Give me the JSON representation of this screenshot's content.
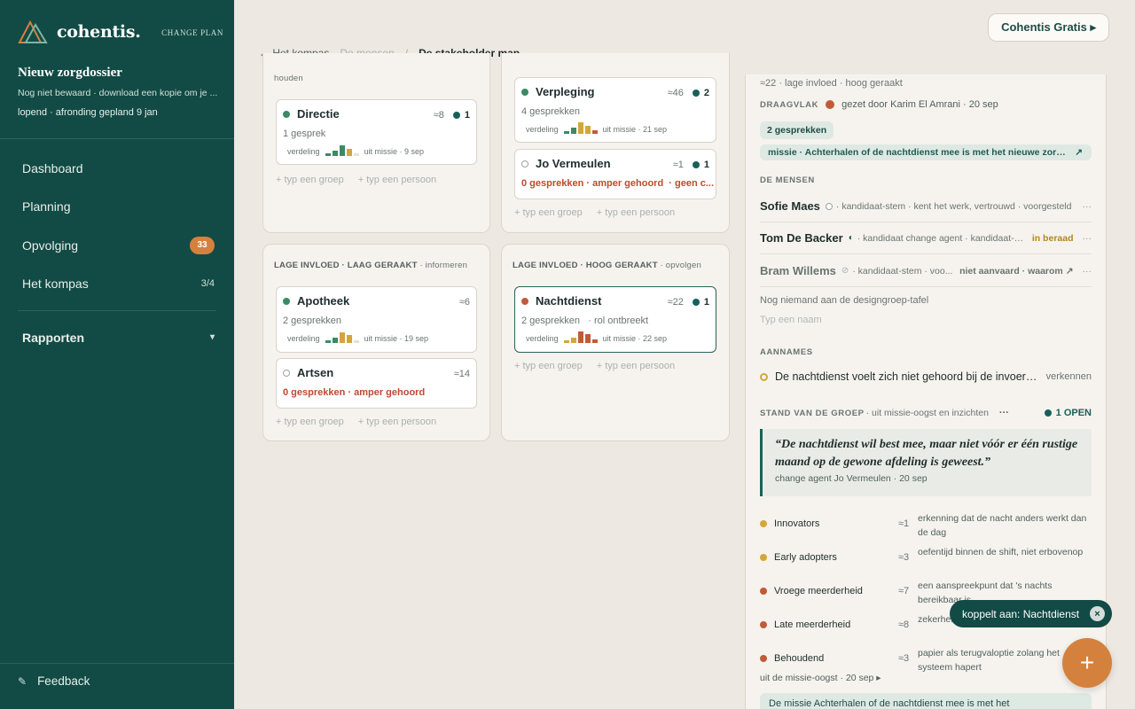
{
  "brand": {
    "name": "cohentis.",
    "change_plan": "CHANGE PLAN"
  },
  "dossier": {
    "title": "Nieuw zorgdossier",
    "note": "Nog niet bewaard · download een kopie om je ...",
    "status": "lopend · afronding gepland 9 jan"
  },
  "nav": {
    "dashboard": "Dashboard",
    "planning": "Planning",
    "opvolging": "Opvolging",
    "opvolging_badge": "33",
    "kompas": "Het kompas",
    "kompas_count": "3/4",
    "rapporten": "Rapporten",
    "rapporten_caret": "▾",
    "feedback": "Feedback",
    "feedback_icon": "✎"
  },
  "breadcrumb": {
    "back": "← Het kompas",
    "mid": "De mensen",
    "sep": "/",
    "current": "De stakeholder map"
  },
  "plan_button": "Cohentis Gratis ▸",
  "quadrants": {
    "q1_head_tail": "houden",
    "q3_head": "LAGE INVLOED · LAAG GERAAKT",
    "q3_tail": " · informeren",
    "q4_head": "LAGE INVLOED · HOOG GERAAKT",
    "q4_tail": " · opvolgen",
    "add_group": "+ typ een groep",
    "add_person": "+ typ een persoon"
  },
  "cards": {
    "directie": {
      "name": "Directie",
      "size": "≈8",
      "count": "1",
      "sub": "1 gesprek",
      "dist_label": "verdeling",
      "mission": "uit missie · 9 sep"
    },
    "verpleging": {
      "name": "Verpleging",
      "size": "≈46",
      "count": "2",
      "sub": "4 gesprekken",
      "dist_label": "verdeling",
      "mission": "uit missie · 21 sep"
    },
    "jo": {
      "name": "Jo Vermeulen",
      "size": "≈1",
      "count": "1",
      "sub": "0 gesprekken · amper gehoord",
      "sub2": "· geen c..."
    },
    "apotheek": {
      "name": "Apotheek",
      "size": "≈6",
      "sub": "2 gesprekken",
      "dist_label": "verdeling",
      "mission": "uit missie · 19 sep"
    },
    "artsen": {
      "name": "Artsen",
      "size": "≈14",
      "sub": "0 gesprekken · amper gehoord"
    },
    "nachtdienst": {
      "name": "Nachtdienst",
      "size": "≈22",
      "count": "1",
      "sub": "2 gesprekken",
      "sub2": "· rol ontbreekt",
      "dist_label": "verdeling",
      "mission": "uit missie · 22 sep"
    }
  },
  "panel": {
    "top_meta": "≈22 · lage invloed · hoog geraakt",
    "draagvlak_label": "DRAAGVLAK",
    "draagvlak_text": "gezet door Karim El Amrani · 20 sep",
    "gesprekken_pill": "2 gesprekken",
    "missie_pill": "missie · Achterhalen of de nachtdienst mee is met het nieuwe zorgdossier",
    "missie_arrow": "↗",
    "mensen_label": "DE MENSEN",
    "people": [
      {
        "name": "Sofie Maes",
        "desc": "· kandidaat-stem · kent het werk, vertrouwd · voorgesteld"
      },
      {
        "name": "Tom De Backer",
        "desc": "· kandidaat change agent · kandidaat-stem",
        "tag": "in beraad"
      },
      {
        "name": "Bram Willems",
        "desc": "· kandidaat-stem · voo...",
        "tag": "niet aanvaard · waarom ↗"
      }
    ],
    "more_icon": "···",
    "empty_table": "Nog niemand aan de designgroep-tafel",
    "name_placeholder": "Typ een naam",
    "aannames_label": "AANNAMES",
    "aanname": "De nachtdienst voelt zich niet gehoord bij de invoering van het nieuwe zorgdossier",
    "verkennen": "verkennen",
    "stand_label": "STAND VAN DE GROEP",
    "stand_sub": "· uit missie-oogst en inzichten",
    "stand_open": "1 OPEN",
    "quote": "“De nachtdienst wil best mee, maar niet vóór er één rustige maand op de gewone afdeling is geweest.”",
    "quote_by": "change agent Jo Vermeulen · 20 sep",
    "adopters": [
      {
        "name": "Innovators",
        "n": "≈1",
        "desc": "erkenning dat de nacht anders werkt dan de dag",
        "color": "#d2a63c"
      },
      {
        "name": "Early adopters",
        "n": "≈3",
        "desc": "oefentijd binnen de shift, niet erbovenop",
        "color": "#d2a63c"
      },
      {
        "name": "Vroege meerderheid",
        "n": "≈7",
        "desc": "een aanspreekpunt dat 's nachts bereikbaar is",
        "color": "#c05b3a"
      },
      {
        "name": "Late meerderheid",
        "n": "≈8",
        "desc": "zekerheid dat het werk niet krimpt",
        "color": "#c05b3a"
      },
      {
        "name": "Behoudend",
        "n": "≈3",
        "desc": "papier als terugvaloptie zolang het systeem hapert",
        "color": "#c05b3a"
      }
    ],
    "oogst": "uit de missie-oogst · 20 sep ▸",
    "bottom_note": "De missie Achterhalen of de nachtdienst mee is met het"
  },
  "toast": {
    "text": "koppelt aan: Nachtdienst",
    "close": "×"
  },
  "fab": "+"
}
